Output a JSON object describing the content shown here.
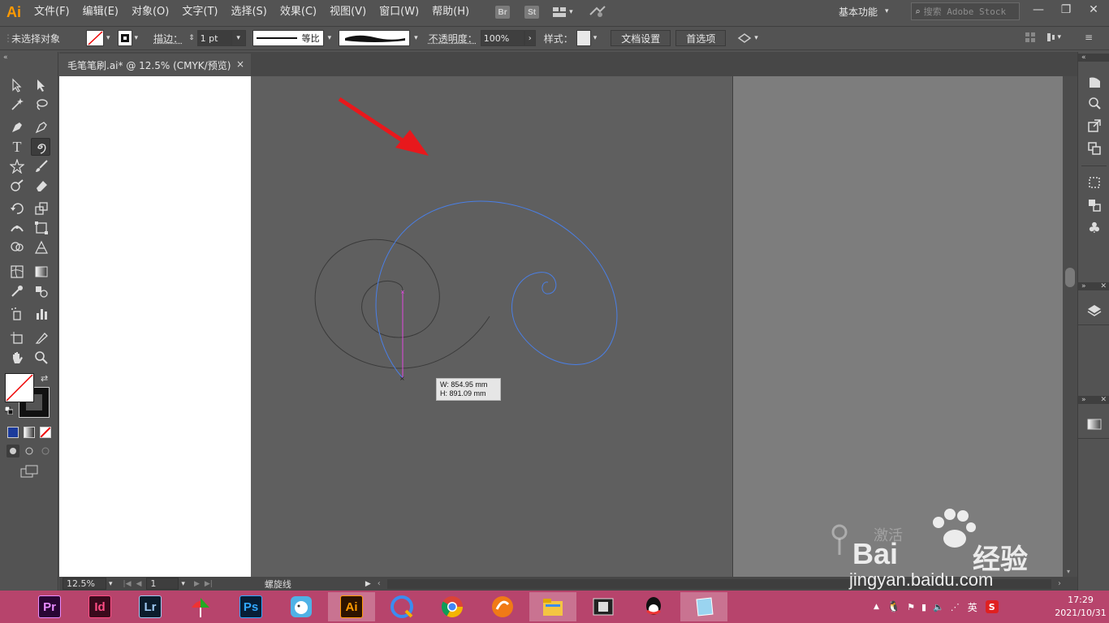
{
  "app": {
    "logo": "Ai",
    "menus": [
      "文件(F)",
      "编辑(E)",
      "对象(O)",
      "文字(T)",
      "选择(S)",
      "效果(C)",
      "视图(V)",
      "窗口(W)",
      "帮助(H)"
    ],
    "badges": [
      "Br",
      "St"
    ],
    "workspace": "基本功能",
    "search_placeholder": "搜索 Adobe Stock"
  },
  "control_bar": {
    "selection_status": "未选择对象",
    "stroke_label": "描边：",
    "stroke_value": "1 pt",
    "stroke_profile": "等比",
    "opacity_label": "不透明度：",
    "opacity_value": "100%",
    "style_label": "样式：",
    "doc_setup_button": "文档设置",
    "preferences_button": "首选项"
  },
  "document": {
    "tab_title": "毛笔笔刷.ai* @ 12.5% (CMYK/预览)",
    "close_symbol": "×",
    "measure_w": "W: 854.95 mm",
    "measure_h": "H: 891.09 mm"
  },
  "status_bar": {
    "zoom": "12.5%",
    "artboard_number": "1",
    "current_tool": "螺旋线"
  },
  "colors": {
    "annotation_arrow": "#e8181c",
    "spiral_selected": "#4a7fe6",
    "spiral_unselected": "#3a3a3a",
    "drag_line": "#e04adf",
    "taskbar": "#b7446c"
  },
  "taskbar": {
    "apps": [
      {
        "label": "Pr",
        "name": "premiere"
      },
      {
        "label": "Id",
        "name": "indesign"
      },
      {
        "label": "Lr",
        "name": "lightroom"
      },
      {
        "label": "",
        "name": "pinyin-tool"
      },
      {
        "label": "Ps",
        "name": "photoshop"
      },
      {
        "label": "",
        "name": "chat-bird"
      },
      {
        "label": "Ai",
        "name": "illustrator"
      },
      {
        "label": "",
        "name": "browser-q"
      },
      {
        "label": "",
        "name": "chrome"
      },
      {
        "label": "",
        "name": "media-player"
      },
      {
        "label": "",
        "name": "file-explorer"
      },
      {
        "label": "",
        "name": "video-editor"
      },
      {
        "label": "",
        "name": "qq"
      },
      {
        "label": "",
        "name": "notepad"
      }
    ],
    "ime": "英",
    "time": "17:29",
    "date": "2021/10/31"
  },
  "watermark": {
    "activate": "激活",
    "brand": "Bai",
    "brand_cn": "经验",
    "url": "jingyan.baidu.com"
  }
}
